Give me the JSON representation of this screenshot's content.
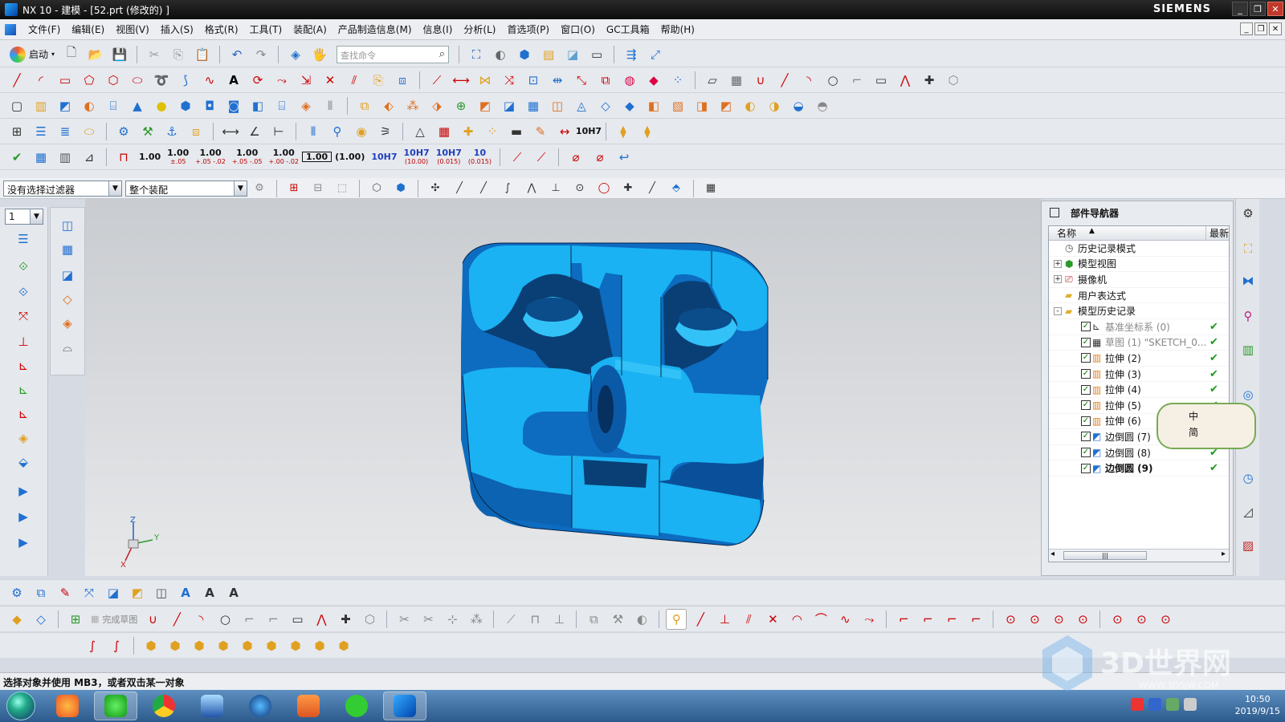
{
  "window": {
    "title": "NX 10 - 建模 - [52.prt  (修改的) ]",
    "brand": "SIEMENS",
    "buttons": [
      "_",
      "❐",
      "✕"
    ]
  },
  "menubar": {
    "items": [
      "文件(F)",
      "编辑(E)",
      "视图(V)",
      "插入(S)",
      "格式(R)",
      "工具(T)",
      "装配(A)",
      "产品制造信息(M)",
      "信息(I)",
      "分析(L)",
      "首选项(P)",
      "窗口(O)",
      "GC工具箱",
      "帮助(H)"
    ]
  },
  "toolbar": {
    "start_label": "启动",
    "search_placeholder": "查找命令",
    "dims": [
      {
        "main": "1.00",
        "tol": ""
      },
      {
        "main": "1.00",
        "tol": "±.05"
      },
      {
        "main": "1.00",
        "tol": "+.05 -.02"
      },
      {
        "main": "1.00",
        "tol": "+.05 -.05"
      },
      {
        "main": "1.00",
        "tol": "+.00 -.02"
      },
      {
        "main": "1.00",
        "tol": ""
      },
      {
        "main": "(1.00)",
        "tol": ""
      },
      {
        "main": "10H7",
        "tol": ""
      },
      {
        "main": "10H7",
        "tol": "(10.00)"
      },
      {
        "main": "10H7",
        "tol": "(0.015)"
      },
      {
        "main": "10",
        "tol": "(0.015)"
      }
    ],
    "thread_label": "10H7"
  },
  "filterbar": {
    "type_filter": "没有选择过滤器",
    "scope": "整个装配"
  },
  "layer": {
    "value": "1"
  },
  "navigator": {
    "title": "部件导航器",
    "col_name": "名称",
    "col_latest": "最新",
    "rows": [
      {
        "label": "历史记录模式",
        "indent": 0,
        "expand": "",
        "icon": "clock",
        "check": false,
        "ok": false,
        "dim": false,
        "bold": false
      },
      {
        "label": "模型视图",
        "indent": 0,
        "expand": "+",
        "icon": "views",
        "check": false,
        "ok": false,
        "dim": false,
        "bold": false
      },
      {
        "label": "摄像机",
        "indent": 0,
        "expand": "+",
        "icon": "camera",
        "check": false,
        "ok": false,
        "dim": false,
        "bold": false
      },
      {
        "label": "用户表达式",
        "indent": 0,
        "expand": "",
        "icon": "folder",
        "check": false,
        "ok": false,
        "dim": false,
        "bold": false
      },
      {
        "label": "模型历史记录",
        "indent": 0,
        "expand": "-",
        "icon": "folder",
        "check": false,
        "ok": false,
        "dim": false,
        "bold": false
      },
      {
        "label": "基准坐标系 (0)",
        "indent": 1,
        "expand": "",
        "icon": "csys",
        "check": true,
        "ok": true,
        "dim": true,
        "bold": false
      },
      {
        "label": "草图 (1) \"SKETCH_0...",
        "indent": 1,
        "expand": "",
        "icon": "sketch",
        "check": true,
        "ok": true,
        "dim": true,
        "bold": false
      },
      {
        "label": "拉伸 (2)",
        "indent": 1,
        "expand": "",
        "icon": "extrude",
        "check": true,
        "ok": true,
        "dim": false,
        "bold": false
      },
      {
        "label": "拉伸 (3)",
        "indent": 1,
        "expand": "",
        "icon": "extrude",
        "check": true,
        "ok": true,
        "dim": false,
        "bold": false
      },
      {
        "label": "拉伸 (4)",
        "indent": 1,
        "expand": "",
        "icon": "extrude",
        "check": true,
        "ok": true,
        "dim": false,
        "bold": false
      },
      {
        "label": "拉伸 (5)",
        "indent": 1,
        "expand": "",
        "icon": "extrude",
        "check": true,
        "ok": true,
        "dim": false,
        "bold": false
      },
      {
        "label": "拉伸 (6)",
        "indent": 1,
        "expand": "",
        "icon": "extrude",
        "check": true,
        "ok": true,
        "dim": false,
        "bold": false
      },
      {
        "label": "边倒圆 (7)",
        "indent": 1,
        "expand": "",
        "icon": "blend",
        "check": true,
        "ok": true,
        "dim": false,
        "bold": false
      },
      {
        "label": "边倒圆 (8)",
        "indent": 1,
        "expand": "",
        "icon": "blend",
        "check": true,
        "ok": true,
        "dim": false,
        "bold": false
      },
      {
        "label": "边倒圆 (9)",
        "indent": 1,
        "expand": "",
        "icon": "blend",
        "check": true,
        "ok": true,
        "dim": false,
        "bold": true
      }
    ]
  },
  "ime": {
    "line1": "中",
    "line2": "简"
  },
  "sketch_toolbar": {
    "finish_label": "完成草图"
  },
  "status": {
    "prompt": "选择对象并使用 MB3，或者双击某一对象"
  },
  "taskbar": {
    "time": "10:50",
    "date": "2019/9/15"
  },
  "triad": {
    "x": "X",
    "y": "Y",
    "z": "Z"
  },
  "watermark": {
    "text": "3D世界网",
    "url": "WWW.3DSJW.COM"
  },
  "colors": {
    "part_top": "#22b8f5",
    "part_side": "#0a5fa8",
    "part_dark": "#0a3f75"
  }
}
